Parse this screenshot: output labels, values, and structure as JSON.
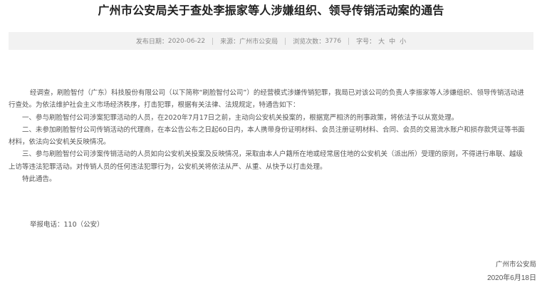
{
  "article": {
    "title": "广州市公安局关于查处李振家等人涉嫌组织、领导传销活动案的通告"
  },
  "meta": {
    "publish_label": "发布日期：",
    "publish_date": "2020-06-22",
    "source_label": "来源：",
    "source": "广州市公安局",
    "views_label": "浏览次数：",
    "views": "3776",
    "fontsize_label": "字号：",
    "sizes": [
      "大",
      "中",
      "小"
    ]
  },
  "paragraphs": [
    "经调查，刷脸智付（广东）科技股份有限公司（以下简称“刷脸智付公司”）的经营模式涉嫌传销犯罪，我局已对该公司的负责人李振家等人涉嫌组织、领导传销活动进行查处。为依法维护社会主义市场经济秩序，打击犯罪，根据有关法律、法规规定，特通告如下：",
    "一、参与刷脸智付公司涉案犯罪活动的人员，在2020年7月17日之前，主动向公安机关投案的，根据宽严相济的刑事政策，将依法予以从宽处理。",
    "二、未参加刷脸智付公司传销活动的代理商，在本公告公布之日起60日内，本人携带身份证明材料、会员注册证明材料、合同、会员的交易流水账户和损存款凭证等书面材料，依法向公安机关反映情况。",
    "三、参与刷脸智付公司涉案传销活动的人员如向公安机关投案及反映情况，采取由本人户籍所在地或经常居住地的公安机关（派出所）受理的原则，不得进行串联、越级上访等违法犯罪活动。对传销人员的任何违法犯罪行为，公安机关将依法从严、从重、从快予以打击处理。",
    "特此通告。"
  ],
  "hotline": {
    "label": "举报电话：",
    "value": "110（公安）"
  },
  "signature": {
    "org": "广州市公安局",
    "date": "2020年6月18日"
  }
}
